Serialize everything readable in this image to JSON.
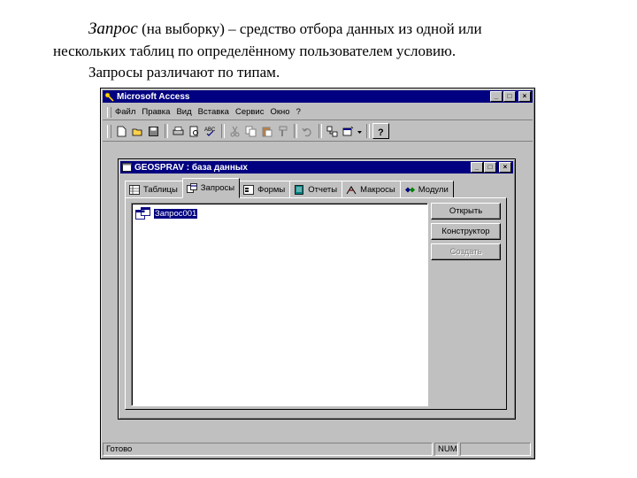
{
  "slide": {
    "term": "Запрос",
    "line1_rest": " (на выборку) – средство отбора данных из одной или",
    "line2": "нескольких таблиц по определённому пользователем условию.",
    "line3": "Запросы различают по типам."
  },
  "app_window": {
    "title": "Microsoft Access",
    "menu": [
      "Файл",
      "Правка",
      "Вид",
      "Вставка",
      "Сервис",
      "Окно",
      "?"
    ],
    "toolbar_icons": [
      "new-icon",
      "open-icon",
      "save-icon",
      "print-icon",
      "print-preview-icon",
      "spelling-icon",
      "cut-icon",
      "copy-icon",
      "paste-icon",
      "format-painter-icon",
      "undo-icon",
      "relationships-icon",
      "new-object-icon",
      "help-icon"
    ]
  },
  "db_window": {
    "title": "GEOSPRAV : база данных",
    "tabs": [
      {
        "label": "Таблицы",
        "icon": "table-icon"
      },
      {
        "label": "Запросы",
        "icon": "query-icon"
      },
      {
        "label": "Формы",
        "icon": "form-icon"
      },
      {
        "label": "Отчеты",
        "icon": "report-icon"
      },
      {
        "label": "Макросы",
        "icon": "macro-icon"
      },
      {
        "label": "Модули",
        "icon": "module-icon"
      }
    ],
    "active_tab": "Запросы",
    "list_items": [
      "Запрос001"
    ],
    "buttons": {
      "open": "Открыть",
      "design": "Конструктор",
      "create": "Создать"
    }
  },
  "statusbar": {
    "text": "Готово",
    "num": "NUM"
  },
  "colors": {
    "titlebar": "#000080",
    "face": "#c0c0c0"
  }
}
